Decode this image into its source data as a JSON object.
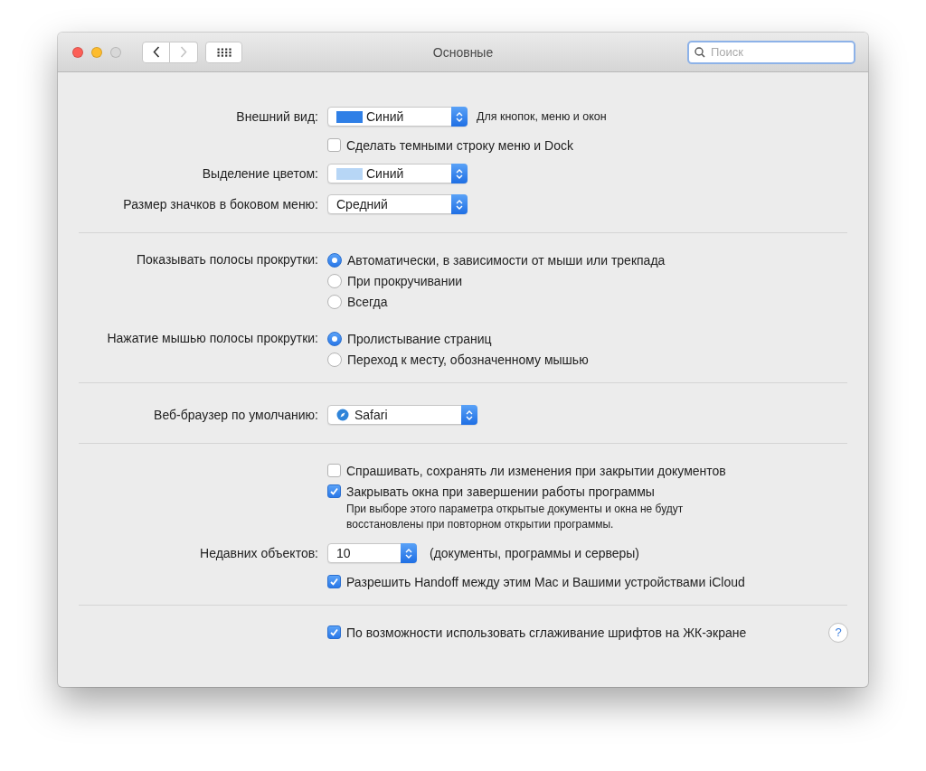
{
  "window": {
    "title": "Основные",
    "search": {
      "placeholder": "Поиск"
    }
  },
  "sections": [
    {
      "rows": [
        {
          "kind": "popup",
          "label": "Внешний вид:",
          "value": "Синий",
          "color": "#2f7fe6",
          "note": "Для кнопок, меню и окон"
        },
        {
          "kind": "checkbox",
          "text": "Сделать темными строку меню и Dock",
          "checked": false
        },
        {
          "kind": "popup",
          "label": "Выделение цветом:",
          "value": "Синий",
          "color": "#b7d6f6"
        },
        {
          "kind": "popup",
          "label": "Размер значков в боковом меню:",
          "value": "Средний"
        }
      ]
    },
    {
      "rows": [
        {
          "kind": "radio",
          "label": "Показывать полосы прокрутки:",
          "options": [
            {
              "text": "Автоматически, в зависимости от мыши или трекпада",
              "selected": true
            },
            {
              "text": "При прокручивании",
              "selected": false
            },
            {
              "text": "Всегда",
              "selected": false
            }
          ]
        },
        {
          "kind": "radio",
          "label": "Нажатие мышью полосы прокрутки:",
          "options": [
            {
              "text": "Пролистывание страниц",
              "selected": true
            },
            {
              "text": "Переход к месту, обозначенному мышью",
              "selected": false
            }
          ]
        }
      ]
    },
    {
      "rows": [
        {
          "kind": "app-popup",
          "label": "Веб-браузер по умолчанию:",
          "value": "Safari"
        }
      ]
    },
    {
      "rows": [
        {
          "kind": "checkbox",
          "text": "Спрашивать, сохранять ли изменения при закрытии документов",
          "checked": false
        },
        {
          "kind": "checkbox",
          "text": "Закрывать окна при завершении работы программы",
          "checked": true
        },
        {
          "kind": "note",
          "text": "При выборе этого параметра открытые документы и окна не будут восстановлены при повторном открытии программы."
        },
        {
          "kind": "number-popup",
          "label": "Недавних объектов:",
          "value": "10",
          "note": "(документы, программы и серверы)"
        },
        {
          "kind": "checkbox",
          "text": "Разрешить Handoff между этим Mac и Вашими устройствами iCloud",
          "checked": true
        }
      ]
    },
    {
      "rows": [
        {
          "kind": "checkbox",
          "text": "По возможности использовать сглаживание шрифтов на ЖК-экране",
          "checked": true,
          "help": "?"
        }
      ]
    }
  ]
}
